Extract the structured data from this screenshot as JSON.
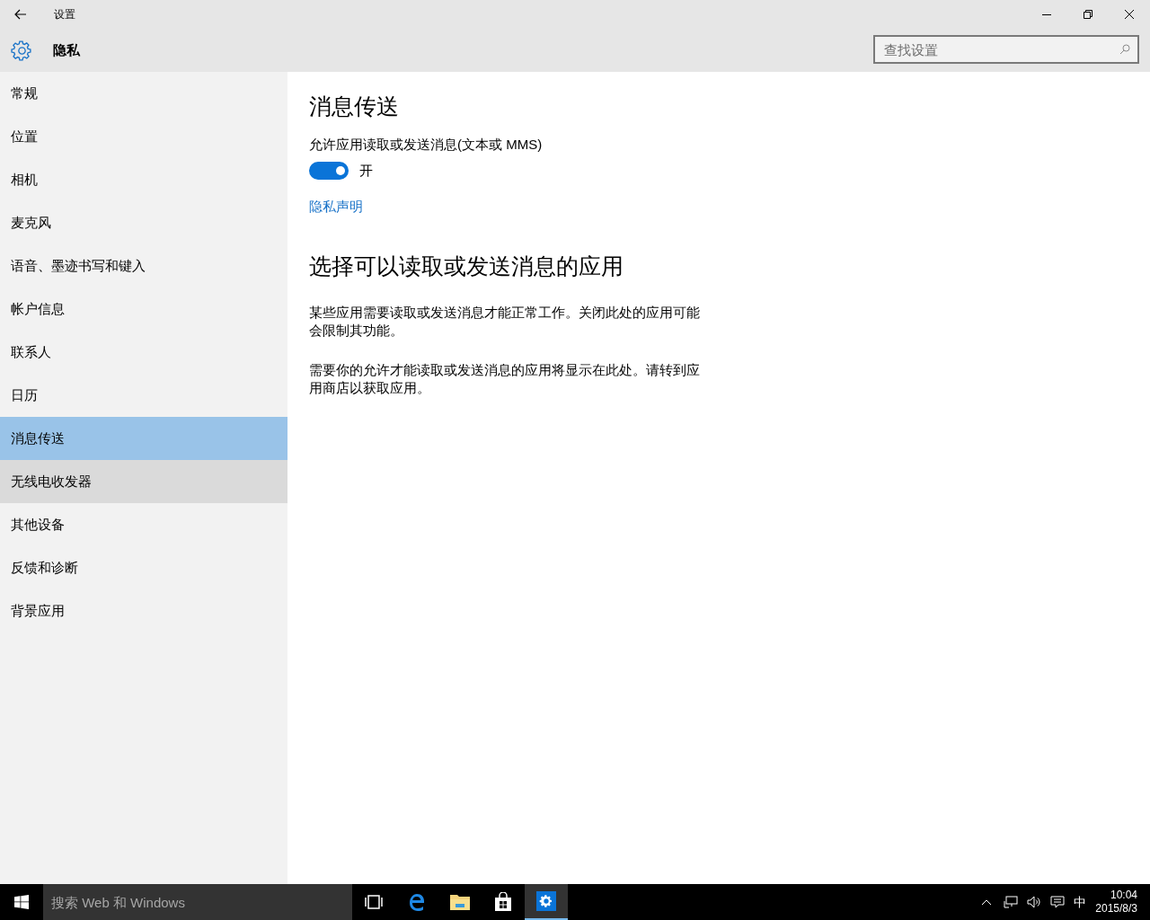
{
  "window": {
    "title": "设置"
  },
  "header": {
    "title": "隐私",
    "search": {
      "placeholder": "查找设置"
    }
  },
  "sidebar": {
    "items": [
      {
        "label": "常规",
        "selected": false,
        "hovered": false
      },
      {
        "label": "位置",
        "selected": false,
        "hovered": false
      },
      {
        "label": "相机",
        "selected": false,
        "hovered": false
      },
      {
        "label": "麦克风",
        "selected": false,
        "hovered": false
      },
      {
        "label": "语音、墨迹书写和键入",
        "selected": false,
        "hovered": false
      },
      {
        "label": "帐户信息",
        "selected": false,
        "hovered": false
      },
      {
        "label": "联系人",
        "selected": false,
        "hovered": false
      },
      {
        "label": "日历",
        "selected": false,
        "hovered": false
      },
      {
        "label": "消息传送",
        "selected": true,
        "hovered": false
      },
      {
        "label": "无线电收发器",
        "selected": false,
        "hovered": true
      },
      {
        "label": "其他设备",
        "selected": false,
        "hovered": false
      },
      {
        "label": "反馈和诊断",
        "selected": false,
        "hovered": false
      },
      {
        "label": "背景应用",
        "selected": false,
        "hovered": false
      }
    ]
  },
  "content": {
    "title": "消息传送",
    "toggle": {
      "label": "允许应用读取或发送消息(文本或 MMS)",
      "on": true,
      "state_text": "开"
    },
    "link": "隐私声明",
    "section_title": "选择可以读取或发送消息的应用",
    "paragraphs": [
      "某些应用需要读取或发送消息才能正常工作。关闭此处的应用可能会限制其功能。",
      "需要你的允许才能读取或发送消息的应用将显示在此处。请转到应用商店以获取应用。"
    ]
  },
  "taskbar": {
    "search_placeholder": "搜索 Web 和 Windows",
    "apps": [
      {
        "kind": "taskview",
        "active": false
      },
      {
        "kind": "edge",
        "active": false
      },
      {
        "kind": "explorer",
        "active": false
      },
      {
        "kind": "store",
        "active": false
      },
      {
        "kind": "settings",
        "active": true
      }
    ],
    "ime": "中",
    "time": "10:04",
    "date": "2015/8/3"
  }
}
